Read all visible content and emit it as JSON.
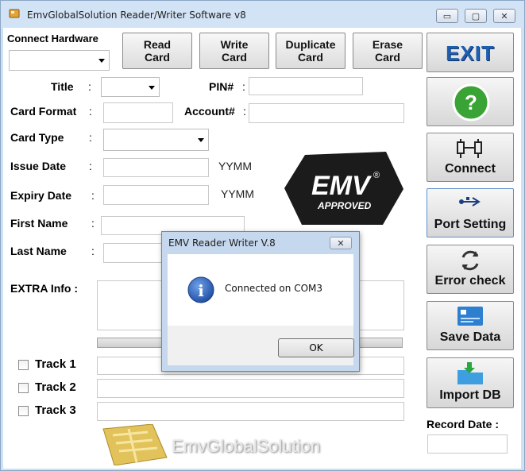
{
  "window": {
    "title": "EmvGlobalSolution Reader/Writer Software v8",
    "minimize_glyph": "▭",
    "maximize_glyph": "▢",
    "close_glyph": "✕"
  },
  "connect": {
    "label": "Connect Hardware",
    "value": ""
  },
  "toolbar": {
    "read_line1": "Read",
    "read_line2": "Card",
    "write_line1": "Write",
    "write_line2": "Card",
    "duplicate_line1": "Duplicate",
    "duplicate_line2": "Card",
    "erase_line1": "Erase",
    "erase_line2": "Card"
  },
  "sidebar": {
    "exit_label": "EXIT",
    "help_glyph": "?",
    "connect_label": "Connect",
    "port_label": "Port Setting",
    "error_label": "Error check",
    "save_label": "Save Data",
    "import_label": "Import DB"
  },
  "form": {
    "colon": ":",
    "title_label": "Title",
    "pin_label": "PIN#",
    "card_format_label": "Card Format",
    "account_label": "Account#",
    "card_type_label": "Card Type",
    "issue_date_label": "Issue Date",
    "issue_date_unit": "YYMM",
    "expiry_date_label": "Expiry Date",
    "expiry_date_unit": "YYMM",
    "first_name_label": "First Name",
    "last_name_label": "Last Name",
    "extra_info_label": "EXTRA Info :",
    "track1_label": "Track 1",
    "track2_label": "Track 2",
    "track3_label": "Track 3",
    "record_date_label": "Record Date :"
  },
  "emv_logo": {
    "text": "EMV",
    "sub": "APPROVED",
    "mark": "®"
  },
  "brand": {
    "text": "EmvGlobalSolution"
  },
  "dialog": {
    "title": "EMV Reader Writer V.8",
    "close_glyph": "✕",
    "message": "Connected on COM3",
    "icon_glyph": "i",
    "ok_label": "OK"
  },
  "colors": {
    "accent_blue": "#1f5fb0",
    "window_frame": "#cfe0f3",
    "help_green": "#3aa335"
  }
}
